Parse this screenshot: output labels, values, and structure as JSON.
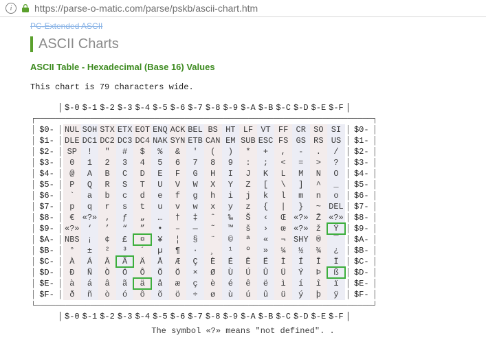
{
  "url": "https://parse-o-matic.com/parse/pskb/ascii-chart.htm",
  "breadcrumb_prev": "PC-Extended ASCII",
  "heading": "ASCII Charts",
  "subheading": "ASCII Table - Hexadecimal (Base 16) Values",
  "intro_line": "This chart is 79 characters wide.",
  "footer_note": "The symbol «?» means \"not defined\". .",
  "col_headers": [
    "$-0",
    "$-1",
    "$-2",
    "$-3",
    "$-4",
    "$-5",
    "$-6",
    "$-7",
    "$-8",
    "$-9",
    "$-A",
    "$-B",
    "$-C",
    "$-D",
    "$-E",
    "$-F"
  ],
  "row_labels": [
    "$0-",
    "$1-",
    "$2-",
    "$3-",
    "$4-",
    "$5-",
    "$6-",
    "$7-",
    "$8-",
    "$9-",
    "$A-",
    "$B-",
    "$C-",
    "$D-",
    "$E-",
    "$F-"
  ],
  "highlights": [
    [
      9,
      15
    ],
    [
      10,
      4
    ],
    [
      12,
      3
    ],
    [
      13,
      15
    ],
    [
      14,
      4
    ]
  ],
  "chart_data": {
    "type": "table",
    "title": "ASCII Table - Hexadecimal (Base 16) Values",
    "rows": [
      [
        "NUL",
        "SOH",
        "STX",
        "ETX",
        "EOT",
        "ENQ",
        "ACK",
        "BEL",
        "BS",
        "HT",
        "LF",
        "VT",
        "FF",
        "CR",
        "SO",
        "SI"
      ],
      [
        "DLE",
        "DC1",
        "DC2",
        "DC3",
        "DC4",
        "NAK",
        "SYN",
        "ETB",
        "CAN",
        "EM",
        "SUB",
        "ESC",
        "FS",
        "GS",
        "RS",
        "US"
      ],
      [
        "SP",
        "!",
        "\"",
        "#",
        "$",
        "%",
        "&",
        "'",
        "(",
        ")",
        "*",
        "+",
        ",",
        "-",
        ".",
        "/"
      ],
      [
        "0",
        "1",
        "2",
        "3",
        "4",
        "5",
        "6",
        "7",
        "8",
        "9",
        ":",
        ";",
        "<",
        "=",
        ">",
        "?"
      ],
      [
        "@",
        "A",
        "B",
        "C",
        "D",
        "E",
        "F",
        "G",
        "H",
        "I",
        "J",
        "K",
        "L",
        "M",
        "N",
        "O"
      ],
      [
        "P",
        "Q",
        "R",
        "S",
        "T",
        "U",
        "V",
        "W",
        "X",
        "Y",
        "Z",
        "[",
        "\\",
        "]",
        "^",
        "_"
      ],
      [
        "`",
        "a",
        "b",
        "c",
        "d",
        "e",
        "f",
        "g",
        "h",
        "i",
        "j",
        "k",
        "l",
        "m",
        "n",
        "o"
      ],
      [
        "p",
        "q",
        "r",
        "s",
        "t",
        "u",
        "v",
        "w",
        "x",
        "y",
        "z",
        "{",
        "|",
        "}",
        "~",
        "DEL"
      ],
      [
        "€",
        "«?»",
        "‚",
        "ƒ",
        "„",
        "…",
        "†",
        "‡",
        "ˆ",
        "‰",
        "Š",
        "‹",
        "Œ",
        "«?»",
        "Ž",
        "«?»"
      ],
      [
        "«?»",
        "‘",
        "’",
        "“",
        "”",
        "•",
        "–",
        "—",
        "˜",
        "™",
        "š",
        "›",
        "œ",
        "«?»",
        "ž",
        "Ÿ"
      ],
      [
        "NBS",
        "¡",
        "¢",
        "£",
        "¤",
        "¥",
        "¦",
        "§",
        "¨",
        "©",
        "ª",
        "«",
        "¬",
        "SHY",
        "®",
        "¯"
      ],
      [
        "°",
        "±",
        "²",
        "³",
        "´",
        "µ",
        "¶",
        "·",
        "¸",
        "¹",
        "º",
        "»",
        "¼",
        "½",
        "¾",
        "¿"
      ],
      [
        "À",
        "Á",
        "Â",
        "Ã",
        "Ä",
        "Å",
        "Æ",
        "Ç",
        "È",
        "É",
        "Ê",
        "Ë",
        "Ì",
        "Í",
        "Î",
        "Ï"
      ],
      [
        "Ð",
        "Ñ",
        "Ò",
        "Ó",
        "Ô",
        "Õ",
        "Ö",
        "×",
        "Ø",
        "Ù",
        "Ú",
        "Û",
        "Ü",
        "Ý",
        "Þ",
        "ß"
      ],
      [
        "à",
        "á",
        "â",
        "ã",
        "ä",
        "å",
        "æ",
        "ç",
        "è",
        "é",
        "ê",
        "ë",
        "ì",
        "í",
        "î",
        "ï"
      ],
      [
        "ð",
        "ñ",
        "ò",
        "ó",
        "ô",
        "õ",
        "ö",
        "÷",
        "ø",
        "ù",
        "ú",
        "û",
        "ü",
        "ý",
        "þ",
        "ÿ"
      ]
    ]
  }
}
